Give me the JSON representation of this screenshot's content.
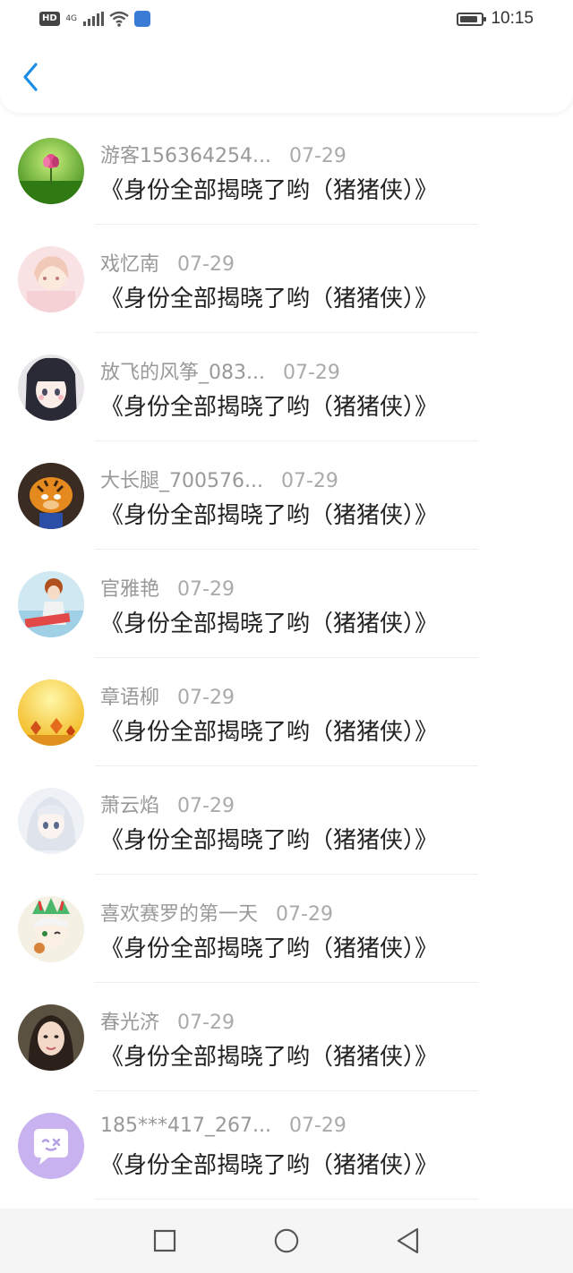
{
  "status_bar": {
    "hd_label": "HD",
    "network_label": "4G",
    "time": "10:15",
    "battery_level": 0.85
  },
  "header": {
    "back_icon": "chevron-left-icon",
    "accent_color": "#1a8ee6"
  },
  "list": {
    "items": [
      {
        "name": "游客156364254...",
        "date": "07-29",
        "title": "《身份全部揭晓了哟（猪猪侠）》",
        "avatar": "flower-pink-avatar"
      },
      {
        "name": "戏忆南",
        "date": "07-29",
        "title": "《身份全部揭晓了哟（猪猪侠）》",
        "avatar": "anime-girl-pink-avatar"
      },
      {
        "name": "放飞的风筝_083...",
        "date": "07-29",
        "title": "《身份全部揭晓了哟（猪猪侠）》",
        "avatar": "anime-girl-dark-hair-avatar"
      },
      {
        "name": "大长腿_700576...",
        "date": "07-29",
        "title": "《身份全部揭晓了哟（猪猪侠）》",
        "avatar": "tiger-cartoon-avatar"
      },
      {
        "name": "官雅艳",
        "date": "07-29",
        "title": "《身份全部揭晓了哟（猪猪侠）》",
        "avatar": "cartoon-girl-avatar"
      },
      {
        "name": "章语柳",
        "date": "07-29",
        "title": "《身份全部揭晓了哟（猪猪侠）》",
        "avatar": "autumn-leaves-avatar"
      },
      {
        "name": "萧云焰",
        "date": "07-29",
        "title": "《身份全部揭晓了哟（猪猪侠）》",
        "avatar": "anime-white-hair-avatar"
      },
      {
        "name": "喜欢赛罗的第一天",
        "date": "07-29",
        "title": "《身份全部揭晓了哟（猪猪侠）》",
        "avatar": "anime-chibi-avatar"
      },
      {
        "name": "春光济",
        "date": "07-29",
        "title": "《身份全部揭晓了哟（猪猪侠）》",
        "avatar": "woman-portrait-avatar"
      },
      {
        "name": "185***417_267...",
        "date": "07-29",
        "title": "《身份全部揭晓了哟（猪猪侠）》",
        "avatar": "default-chat-avatar"
      }
    ]
  },
  "nav_bar": {
    "buttons": [
      "recent-apps-icon",
      "home-icon",
      "back-triangle-icon"
    ]
  }
}
